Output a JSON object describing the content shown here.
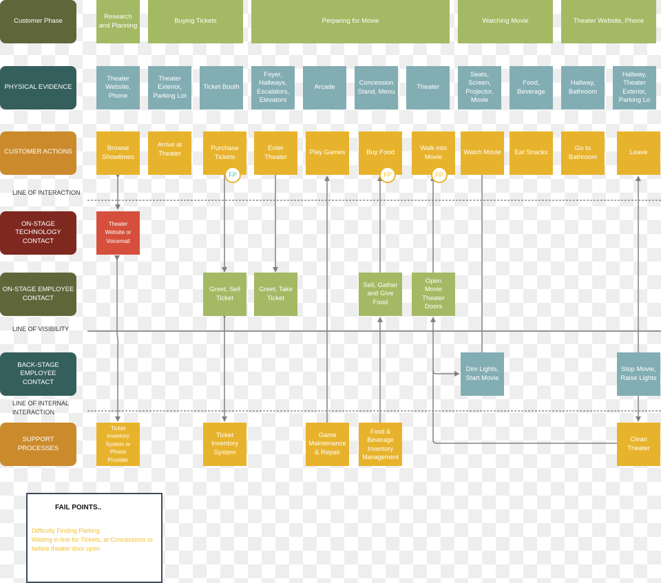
{
  "colors": {
    "phase_lane": "#5f663a",
    "physical_lane": "#345f5c",
    "customer_lane": "#cb8a2c",
    "tech_lane": "#7f2820",
    "onstage_lane": "#5f663a",
    "backstage_lane": "#345f5c",
    "support_lane": "#cb8a2c",
    "phase_box": "#a4b964",
    "physical_box": "#82adb3",
    "action_box": "#e8b32c",
    "tech_box": "#d64f3c",
    "onstage_box": "#a4b964",
    "backstage_box": "#82adb3",
    "support_box": "#e8b32c",
    "fp_text_teal": "#4bbfb8",
    "fp_text_yellow": "#f2c12e",
    "connector": "#808080"
  },
  "lanes": {
    "phase": "Customer Phase",
    "physical": "PHYSICAL EVIDENCE",
    "customer": "CUSTOMER ACTIONS",
    "tech": "ON-STAGE TECHNOLOGY CONTACT",
    "onstage": "ON-STAGE EMPLOYEE CONTACT",
    "backstage": "BACK-STAGE EMPLOYEE CONTACT",
    "support": "SUPPORT PROCESSES"
  },
  "lines": {
    "interaction": "LINE OF INTERACTION",
    "visibility": "LINE OF VISIBILITY",
    "internal_1": "LINE OF INTERNAL",
    "internal_2": "INTERACTION"
  },
  "phases": [
    "Research and Planning",
    "Buying Tickets",
    "Perparing for Movie",
    "Watching Movie",
    "Theater Website, Phone"
  ],
  "physical": [
    "Theater Website, Phone",
    "Theater Exterior, Parking Lot",
    "Ticket Booth",
    "Foyer, Hallways, Escalators, Elevators",
    "Arcade",
    "Concession Stand, Menu",
    "Theater",
    "Seats, Screen, Projector, Movie",
    "Food, Beverage",
    "Hallway, Bathroom",
    "Hallway, Theater Exterior, Parking Lo"
  ],
  "actions": [
    "Browse Showtimes",
    "Arrive at Theater",
    "Purchase Tickets",
    "Enter Theater",
    "Play Games",
    "Buy Food",
    "Walk into Movie",
    "Watch Movie",
    "Eat Snacks",
    "Go to Bathroom",
    "Leave"
  ],
  "fail_point_badge": "FP",
  "tech": [
    "Theater Website or Voicemail"
  ],
  "onstage": [
    "Greet, Sell Ticket",
    "Greet, Take Ticket",
    "Sell, Gather and Give Food",
    "Open Movie Theater Doors"
  ],
  "backstage": [
    "Dim Lights, Start Movie",
    "Stop Movie, Raise Lights"
  ],
  "support": [
    "Ticket Inventory System or Phone Provider",
    "Ticket Inventory System",
    "Game Maintenance & Repair",
    "Food & Beverage Inventory Management",
    "Clean Theater"
  ],
  "fail_points": {
    "title": "FAIL POINTS..",
    "items": [
      "Difficulty Finding Parking",
      "Waiting in line for Tickets, at Concessions or before theater door open"
    ]
  }
}
